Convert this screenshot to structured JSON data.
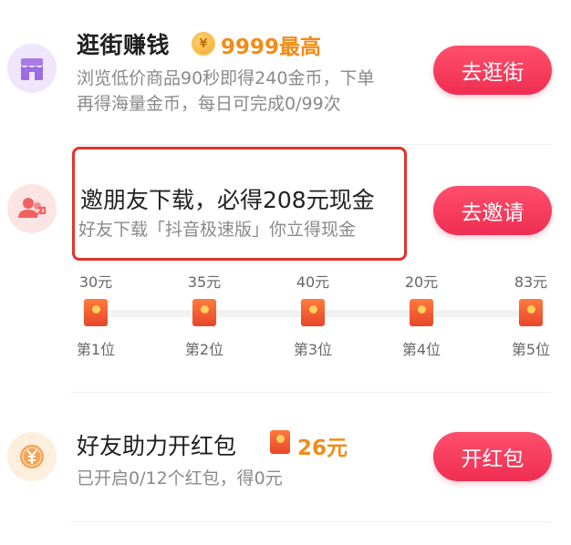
{
  "tasks": [
    {
      "title": "逛街赚钱",
      "reward": "9999最高",
      "coin_symbol": "¥",
      "desc_line1": "浏览低价商品90秒即得240金币，下单",
      "desc_line2": "再得海量金币，每日可完成0/99次",
      "button": "去逛街",
      "icon": "store-icon",
      "icon_bg": "#efe6fb",
      "icon_color": "#9b6de0"
    },
    {
      "title": "邀朋友下载，必得208元现金",
      "desc": "好友下载「抖音极速版」你立得现金",
      "button": "去邀请",
      "icon": "users-icon",
      "icon_bg": "#fde4e4",
      "icon_color": "#f06262",
      "milestones": [
        {
          "amount": "30元",
          "rank": "第1位"
        },
        {
          "amount": "35元",
          "rank": "第2位"
        },
        {
          "amount": "40元",
          "rank": "第3位"
        },
        {
          "amount": "20元",
          "rank": "第4位"
        },
        {
          "amount": "83元",
          "rank": "第5位"
        }
      ]
    },
    {
      "title": "好友助力开红包",
      "reward": "26元",
      "desc": "已开启0/12个红包，得0元",
      "button": "开红包",
      "icon": "yuan-coin-icon",
      "icon_bg": "#fdeede",
      "icon_color": "#f29a4a"
    }
  ],
  "colors": {
    "accent": "#ef2e52",
    "reward": "#f08c19",
    "highlight": "#e0352b"
  }
}
